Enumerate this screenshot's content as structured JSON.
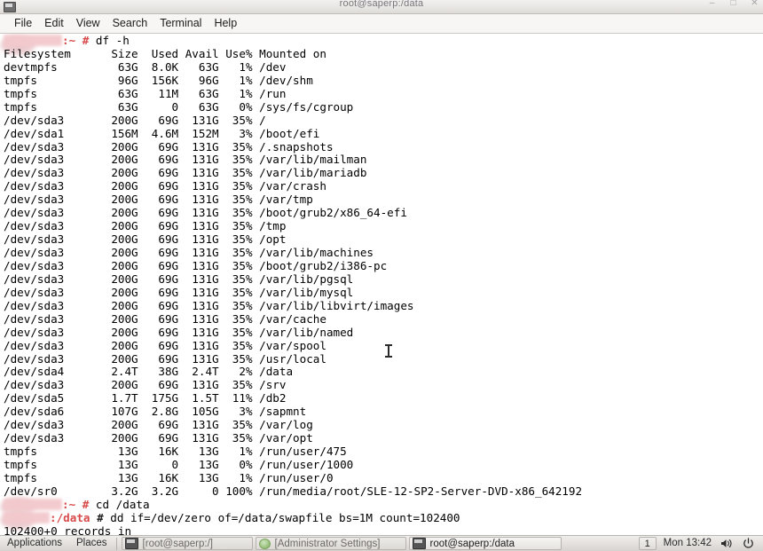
{
  "window": {
    "title": "root@saperp:/data",
    "app_icon": "terminal-icon",
    "controls": {
      "minimize": "–",
      "maximize": "□",
      "close": "✕"
    }
  },
  "menubar": {
    "items": [
      {
        "label": "File"
      },
      {
        "label": "Edit"
      },
      {
        "label": "View"
      },
      {
        "label": "Search"
      },
      {
        "label": "Terminal"
      },
      {
        "label": "Help"
      }
    ]
  },
  "terminal": {
    "prompt_user_redacted": "",
    "commands": {
      "df": "df -h",
      "cd": "cd /data",
      "dd": "dd if=/dev/zero of=/data/swapfile bs=1M count=102400"
    },
    "prompt_home": ":~ # ",
    "prompt_data_path": ":/data",
    "prompt_data_suffix": " # ",
    "df_header": "Filesystem      Size  Used Avail Use% Mounted on",
    "df_rows": [
      "devtmpfs         63G  8.0K   63G   1% /dev",
      "tmpfs            96G  156K   96G   1% /dev/shm",
      "tmpfs            63G   11M   63G   1% /run",
      "tmpfs            63G     0   63G   0% /sys/fs/cgroup",
      "/dev/sda3       200G   69G  131G  35% /",
      "/dev/sda1       156M  4.6M  152M   3% /boot/efi",
      "/dev/sda3       200G   69G  131G  35% /.snapshots",
      "/dev/sda3       200G   69G  131G  35% /var/lib/mailman",
      "/dev/sda3       200G   69G  131G  35% /var/lib/mariadb",
      "/dev/sda3       200G   69G  131G  35% /var/crash",
      "/dev/sda3       200G   69G  131G  35% /var/tmp",
      "/dev/sda3       200G   69G  131G  35% /boot/grub2/x86_64-efi",
      "/dev/sda3       200G   69G  131G  35% /tmp",
      "/dev/sda3       200G   69G  131G  35% /opt",
      "/dev/sda3       200G   69G  131G  35% /var/lib/machines",
      "/dev/sda3       200G   69G  131G  35% /boot/grub2/i386-pc",
      "/dev/sda3       200G   69G  131G  35% /var/lib/pgsql",
      "/dev/sda3       200G   69G  131G  35% /var/lib/mysql",
      "/dev/sda3       200G   69G  131G  35% /var/lib/libvirt/images",
      "/dev/sda3       200G   69G  131G  35% /var/cache",
      "/dev/sda3       200G   69G  131G  35% /var/lib/named",
      "/dev/sda3       200G   69G  131G  35% /var/spool",
      "/dev/sda3       200G   69G  131G  35% /usr/local",
      "/dev/sda4       2.4T   38G  2.4T   2% /data",
      "/dev/sda3       200G   69G  131G  35% /srv",
      "/dev/sda5       1.7T  175G  1.5T  11% /db2",
      "/dev/sda6       107G  2.8G  105G   3% /sapmnt",
      "/dev/sda3       200G   69G  131G  35% /var/log",
      "/dev/sda3       200G   69G  131G  35% /var/opt",
      "tmpfs            13G   16K   13G   1% /run/user/475",
      "tmpfs            13G     0   13G   0% /run/user/1000",
      "tmpfs            13G   16K   13G   1% /run/user/0",
      "/dev/sr0        3.2G  3.2G     0 100% /run/media/root/SLE-12-SP2-Server-DVD-x86_642192"
    ],
    "dd_output_line": "102400+0 records in"
  },
  "taskbar": {
    "applications_label": "Applications",
    "places_label": "Places",
    "windows": [
      {
        "label": "[root@saperp:/]",
        "icon": "terminal-icon",
        "active": false
      },
      {
        "label": "[Administrator Settings]",
        "icon": "yast-icon",
        "active": false
      },
      {
        "label": "root@saperp:/data",
        "icon": "terminal-icon",
        "active": true
      }
    ],
    "workspace": "1",
    "clock": "Mon 13:42",
    "tray": [
      {
        "icon": "volume-icon"
      },
      {
        "icon": "power-icon"
      }
    ]
  },
  "colors": {
    "prompt_red": "#d84a4a",
    "terminal_bg": "#ffffff",
    "terminal_fg": "#000000",
    "chrome_bg": "#e8e6e3"
  }
}
